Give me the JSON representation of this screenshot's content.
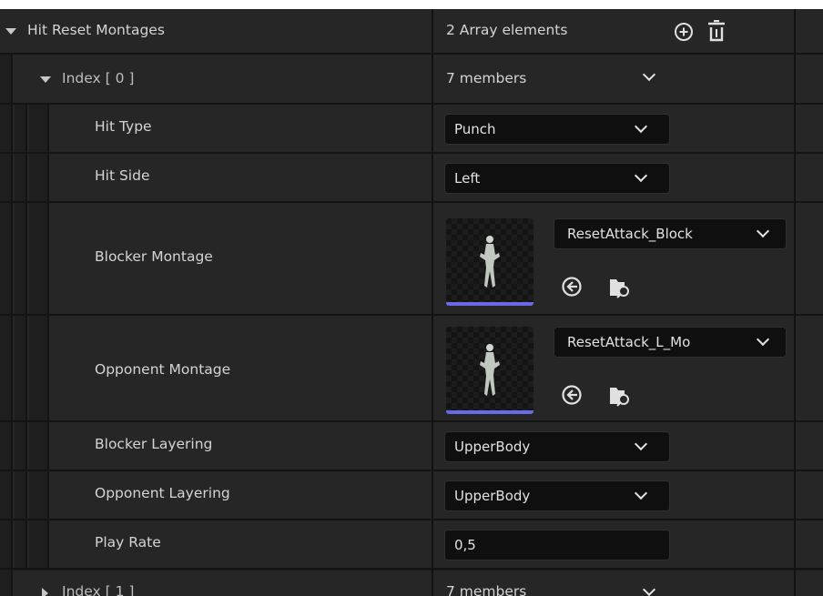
{
  "root": {
    "label": "Hit Reset Montages",
    "summary": "2 Array elements",
    "add_icon": "plus-circle-icon",
    "delete_icon": "trash-icon"
  },
  "index0": {
    "label": "Index [ 0 ]",
    "summary": "7 members"
  },
  "fields": {
    "hit_type": {
      "label": "Hit Type",
      "value": "Punch"
    },
    "hit_side": {
      "label": "Hit Side",
      "value": "Left"
    },
    "blocker_montage": {
      "label": "Blocker Montage",
      "asset": "ResetAttack_Block"
    },
    "opponent_montage": {
      "label": "Opponent Montage",
      "asset": "ResetAttack_L_Mo"
    },
    "blocker_layering": {
      "label": "Blocker Layering",
      "value": "UpperBody"
    },
    "opponent_layering": {
      "label": "Opponent Layering",
      "value": "UpperBody"
    },
    "play_rate": {
      "label": "Play Rate",
      "value": "0,5"
    }
  },
  "index1": {
    "label": "Index [ 1 ]",
    "summary": "7 members"
  },
  "colors": {
    "background": "#1a1a1a",
    "row": "#262626",
    "input": "#0f0f0f",
    "accent_bar": "#6a6ae8"
  }
}
